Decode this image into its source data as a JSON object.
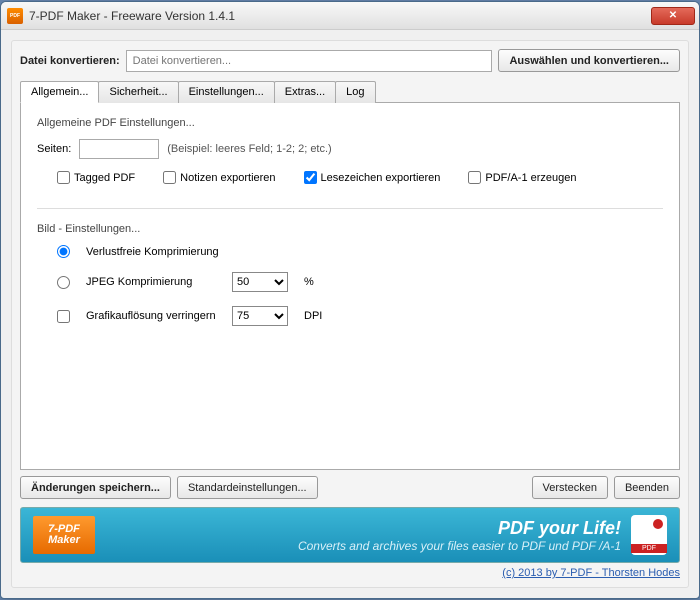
{
  "window": {
    "title": "7-PDF Maker - Freeware Version 1.4.1"
  },
  "topRow": {
    "label": "Datei konvertieren:",
    "placeholder": "Datei konvertieren...",
    "selectBtn": "Auswählen und konvertieren..."
  },
  "tabs": [
    "Allgemein...",
    "Sicherheit...",
    "Einstellungen...",
    "Extras...",
    "Log"
  ],
  "general": {
    "heading": "Allgemeine PDF Einstellungen...",
    "pagesLabel": "Seiten:",
    "pagesValue": "",
    "pagesHint": "(Beispiel: leeres Feld; 1-2; 2; etc.)",
    "cb": {
      "tagged": "Tagged PDF",
      "notes": "Notizen exportieren",
      "bookmarks": "Lesezeichen exportieren",
      "pdfa": "PDF/A-1 erzeugen"
    }
  },
  "image": {
    "heading": "Bild - Einstellungen...",
    "lossless": "Verlustfreie Komprimierung",
    "jpeg": "JPEG Komprimierung",
    "jpegVal": "50",
    "pct": "%",
    "reduce": "Grafikauflösung verringern",
    "dpiVal": "75",
    "dpi": "DPI"
  },
  "bottom": {
    "save": "Änderungen speichern...",
    "defaults": "Standardeinstellungen...",
    "hide": "Verstecken",
    "quit": "Beenden"
  },
  "banner": {
    "logo1": "7-PDF",
    "logo2": "Maker",
    "title": "PDF your Life!",
    "sub": "Converts and archives your files easier to PDF und PDF /A-1"
  },
  "copyright": "(c) 2013 by 7-PDF - Thorsten Hodes"
}
